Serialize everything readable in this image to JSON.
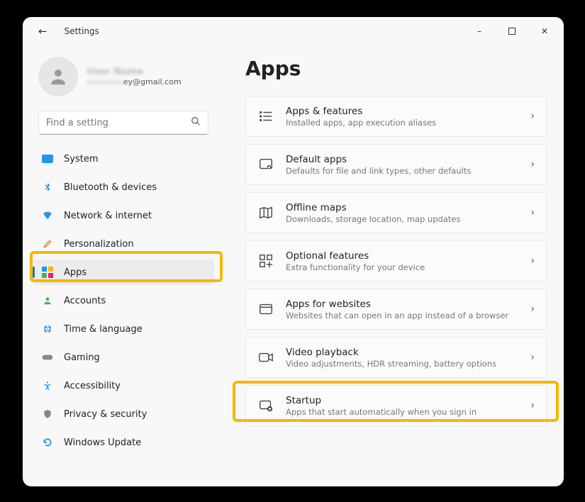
{
  "window": {
    "back_tooltip": "Back",
    "title": "Settings",
    "minimize": "Minimize",
    "maximize": "Maximize",
    "close": "Close"
  },
  "profile": {
    "name_obscured": "User Name",
    "email_suffix": "ey@gmail.com"
  },
  "search": {
    "placeholder": "Find a setting"
  },
  "sidebar": {
    "items": [
      {
        "id": "system",
        "label": "System",
        "icon": "monitor"
      },
      {
        "id": "bluetooth",
        "label": "Bluetooth & devices",
        "icon": "bluetooth"
      },
      {
        "id": "network",
        "label": "Network & internet",
        "icon": "wifi"
      },
      {
        "id": "personalization",
        "label": "Personalization",
        "icon": "brush"
      },
      {
        "id": "apps",
        "label": "Apps",
        "icon": "apps",
        "active": true
      },
      {
        "id": "accounts",
        "label": "Accounts",
        "icon": "person"
      },
      {
        "id": "time-language",
        "label": "Time & language",
        "icon": "globe"
      },
      {
        "id": "gaming",
        "label": "Gaming",
        "icon": "gamepad"
      },
      {
        "id": "accessibility",
        "label": "Accessibility",
        "icon": "accessibility"
      },
      {
        "id": "privacy",
        "label": "Privacy & security",
        "icon": "shield"
      },
      {
        "id": "windows-update",
        "label": "Windows Update",
        "icon": "update"
      }
    ]
  },
  "page": {
    "title": "Apps",
    "sections": [
      {
        "id": "apps-features",
        "title": "Apps & features",
        "subtitle": "Installed apps, app execution aliases",
        "icon": "list"
      },
      {
        "id": "default-apps",
        "title": "Default apps",
        "subtitle": "Defaults for file and link types, other defaults",
        "icon": "default"
      },
      {
        "id": "offline-maps",
        "title": "Offline maps",
        "subtitle": "Downloads, storage location, map updates",
        "icon": "map"
      },
      {
        "id": "optional-features",
        "title": "Optional features",
        "subtitle": "Extra functionality for your device",
        "icon": "plus-grid"
      },
      {
        "id": "apps-for-websites",
        "title": "Apps for websites",
        "subtitle": "Websites that can open in an app instead of a browser",
        "icon": "window"
      },
      {
        "id": "video-playback",
        "title": "Video playback",
        "subtitle": "Video adjustments, HDR streaming, battery options",
        "icon": "video"
      },
      {
        "id": "startup",
        "title": "Startup",
        "subtitle": "Apps that start automatically when you sign in",
        "icon": "startup"
      }
    ]
  },
  "highlights": {
    "sidebar_apps": true,
    "startup_card": true
  }
}
